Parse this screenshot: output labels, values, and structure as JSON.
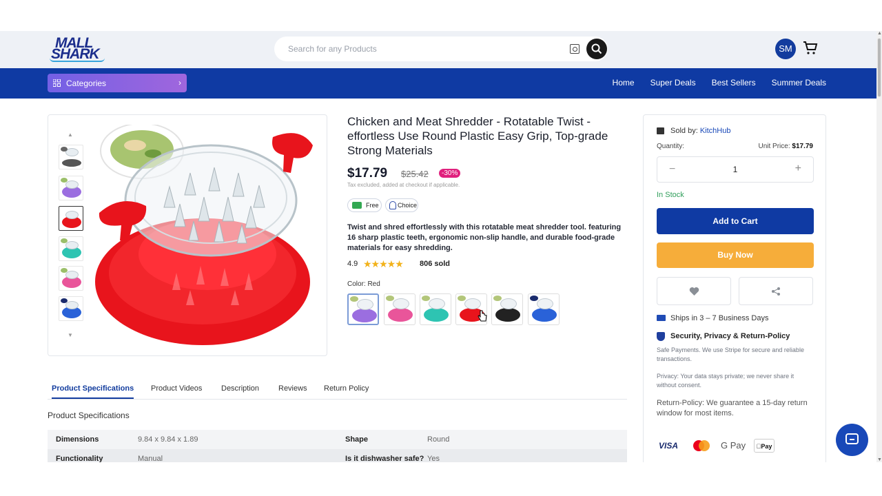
{
  "header": {
    "logo_line1": "MALL",
    "logo_line2": "SHARK",
    "search_placeholder": "Search for any Products",
    "avatar_initials": "SM"
  },
  "nav": {
    "categories_label": "Categories",
    "links": [
      "Home",
      "Super Deals",
      "Best Sellers",
      "Summer Deals"
    ]
  },
  "gallery": {
    "thumbnails": [
      "gray",
      "purple",
      "red",
      "teal",
      "pink",
      "blue"
    ],
    "selected_thumbnail": "red"
  },
  "product": {
    "title": "Chicken and Meat Shredder - Rotatable Twist -effortless Use Round Plastic Easy Grip, Top-grade Strong Materials",
    "price": "$17.79",
    "old_price": "$25.42",
    "discount": "-30%",
    "tax_note": "Tax excluded, added at checkout if applicable.",
    "badge_free": "Free",
    "badge_choice": "Choice",
    "description": "Twist and shred effortlessly with this rotatable meat shredder tool. featuring 16 sharp plastic teeth, ergonomic non-slip handle, and durable food-grade materials for easy shredding.",
    "rating": "4.9",
    "stars": "★★★★★",
    "sold": "806 sold",
    "color_label": "Color: Red",
    "swatches": [
      "purple",
      "pink",
      "teal",
      "red",
      "black",
      "blue"
    ],
    "selected_swatch": "red"
  },
  "buybox": {
    "sold_by_label": "Sold by:",
    "store": "KitchHub",
    "quantity_label": "Quantity:",
    "unit_price_label": "Unit Price:",
    "unit_price": "$17.79",
    "quantity": "1",
    "minus": "−",
    "plus": "+",
    "stock": "In Stock",
    "add_to_cart": "Add to Cart",
    "buy_now": "Buy Now",
    "shipping": "Ships in 3 – 7 Business Days",
    "security_title": "Security, Privacy & Return-Policy",
    "safe_payments": "Safe Payments. We use Stripe for secure and reliable transactions.",
    "privacy": "Privacy: Your data stays private; we never share it without consent.",
    "return_policy": "Return-Policy: We guarantee a 15-day return window for most items.",
    "payments": [
      "VISA",
      "Mastercard",
      "G Pay",
      "Pay"
    ]
  },
  "tabs": {
    "items": [
      "Product Specifications",
      "Product Videos",
      "Description",
      "Reviews",
      "Return Policy"
    ],
    "active": "Product Specifications"
  },
  "specs": {
    "heading": "Product Specifications",
    "rows": [
      {
        "k1": "Dimensions",
        "v1": "9.84 x 9.84 x 1.89",
        "k2": "Shape",
        "v2": "Round"
      },
      {
        "k1": "Functionality",
        "v1": "Manual",
        "k2": "Is it dishwasher safe?",
        "v2": "Yes"
      }
    ]
  },
  "colors": {
    "primary": "#0f3aa3",
    "buy_now": "#f6ad3a",
    "discount": "#e0207d",
    "in_stock": "#2f9e5a",
    "product_red": "#e8141c"
  }
}
